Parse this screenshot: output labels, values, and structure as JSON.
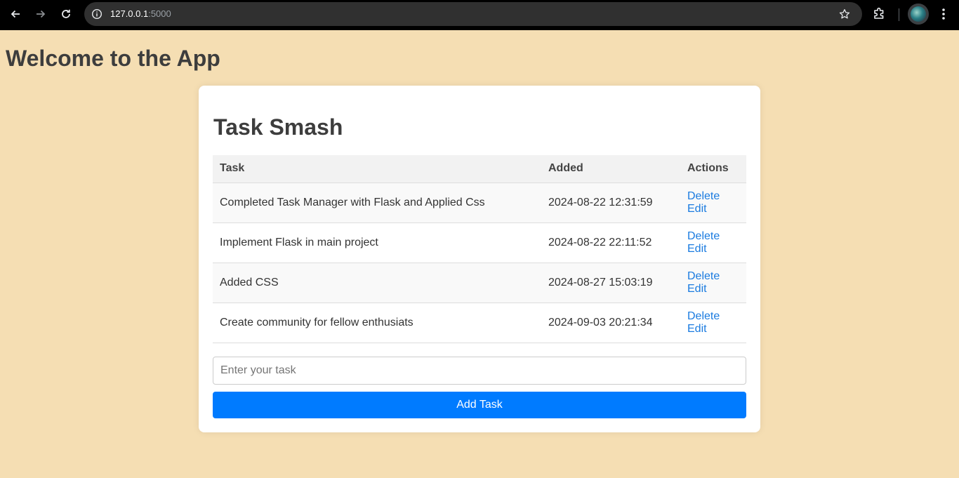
{
  "browser": {
    "url_host": "127.0.0.1",
    "url_port": ":5000"
  },
  "page": {
    "heading": "Welcome to the App"
  },
  "card": {
    "title": "Task Smash",
    "columns": [
      "Task",
      "Added",
      "Actions"
    ],
    "rows": [
      {
        "task": "Completed Task Manager with Flask and Applied Css",
        "added": "2024-08-22 12:31:59",
        "delete": "Delete",
        "edit": "Edit"
      },
      {
        "task": "Implement Flask in main project",
        "added": "2024-08-22 22:11:52",
        "delete": "Delete",
        "edit": "Edit"
      },
      {
        "task": "Added CSS",
        "added": "2024-08-27 15:03:19",
        "delete": "Delete",
        "edit": "Edit"
      },
      {
        "task": "Create community for fellow enthusiats",
        "added": "2024-09-03 20:21:34",
        "delete": "Delete",
        "edit": "Edit"
      }
    ],
    "input_placeholder": "Enter your task",
    "add_button": "Add Task"
  },
  "colors": {
    "background": "#f5deb3",
    "accent": "#007bff",
    "link": "#1a7be0"
  },
  "icons": [
    "back-arrow-icon",
    "forward-arrow-icon",
    "reload-icon",
    "site-info-icon",
    "bookmark-star-icon",
    "extensions-icon",
    "profile-avatar",
    "more-menu-icon"
  ]
}
